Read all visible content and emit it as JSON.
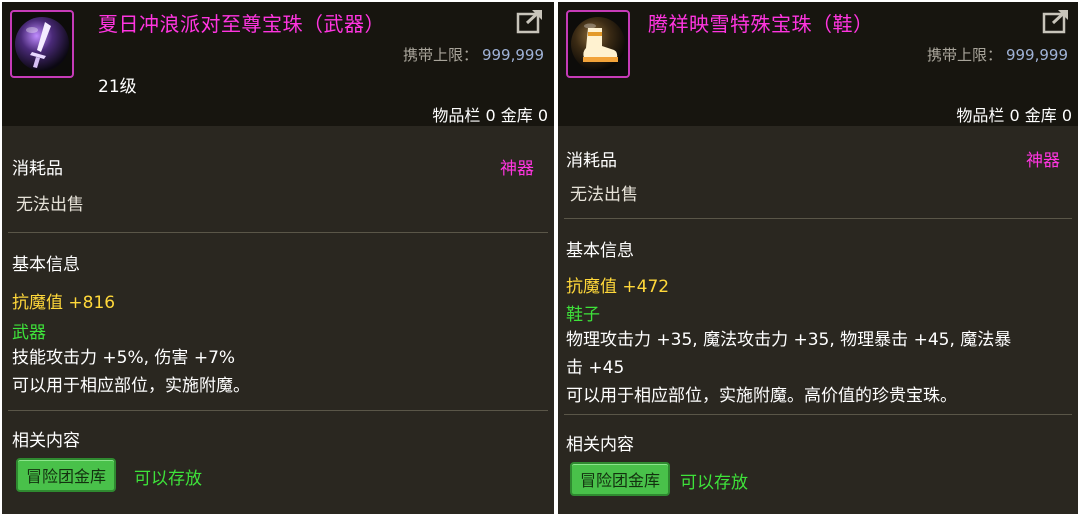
{
  "left": {
    "title": "夏日冲浪派对至尊宝珠（武器）",
    "icon": "sword-orb-icon",
    "limit_label": "携带上限：",
    "limit_value": "999,999",
    "level": "21级",
    "storage": "物品栏 0 金库 0",
    "category": "消耗品",
    "rarity": "神器",
    "sell_status": "无法出售",
    "basic_info": "基本信息",
    "stat": "抗魔值 +816",
    "slot": "武器",
    "effect_line1": "技能攻击力 +5%, 伤害 +7%",
    "effect_line2": "可以用于相应部位，实施附魔。",
    "related": "相关内容",
    "badge": "冒险团金库",
    "badge_note": "可以存放"
  },
  "right": {
    "title": "腾祥映雪特殊宝珠（鞋）",
    "icon": "shoe-orb-icon",
    "limit_label": "携带上限：",
    "limit_value": "999,999",
    "storage": "物品栏 0 金库 0",
    "category": "消耗品",
    "rarity": "神器",
    "sell_status": "无法出售",
    "basic_info": "基本信息",
    "stat": "抗魔值 +472",
    "slot": "鞋子",
    "effect_line1": "物理攻击力 +35, 魔法攻击力 +35, 物理暴击 +45, 魔法暴",
    "effect_line2": "击 +45",
    "effect_line3": "可以用于相应部位，实施附魔。高价值的珍贵宝珠。",
    "related": "相关内容",
    "badge": "冒险团金库",
    "badge_note": "可以存放"
  },
  "colors": {
    "title": "#ff35e0",
    "stat": "#ffd83a",
    "slot": "#3ee23a",
    "panel_bg": "#2a2720",
    "header_bg": "#17150f"
  }
}
